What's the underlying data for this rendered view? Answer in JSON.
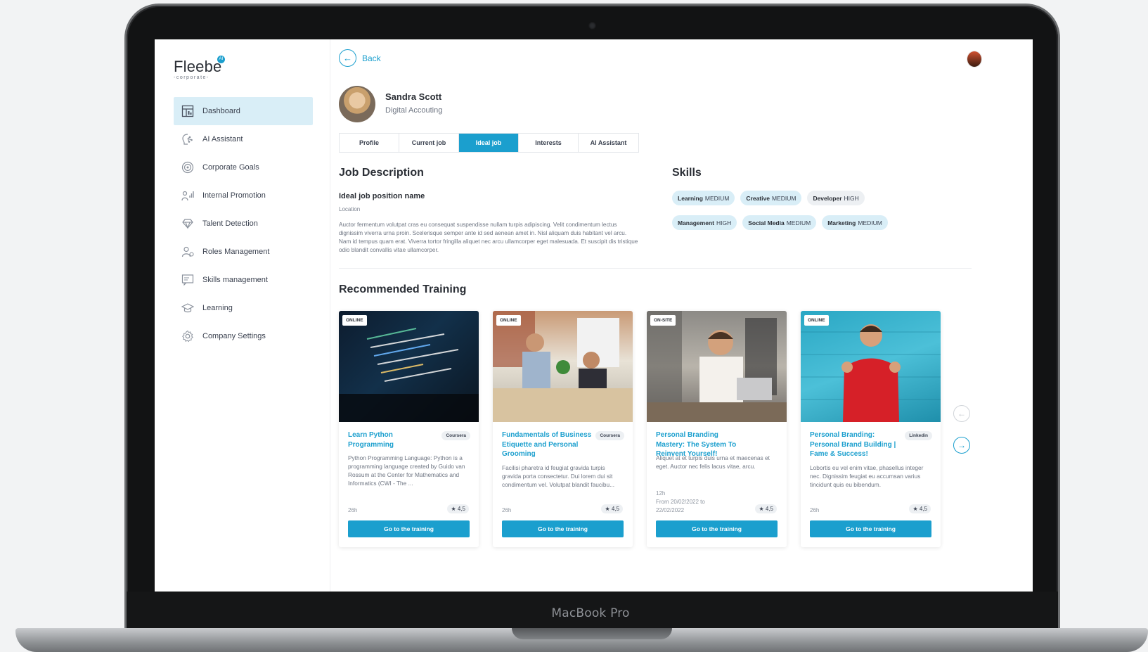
{
  "device": {
    "model_label": "MacBook Pro"
  },
  "brand": {
    "name": "Fleebe",
    "ai_badge": "AI",
    "subtitle": "-corporate-"
  },
  "sidebar": {
    "items": [
      {
        "label": "Dashboard",
        "icon": "dashboard-icon",
        "active": true
      },
      {
        "label": "AI Assistant",
        "icon": "ai-assistant-icon"
      },
      {
        "label": "Corporate Goals",
        "icon": "target-icon"
      },
      {
        "label": "Internal Promotion",
        "icon": "promotion-icon"
      },
      {
        "label": "Talent Detection",
        "icon": "diamond-icon"
      },
      {
        "label": "Roles Management",
        "icon": "users-icon"
      },
      {
        "label": "Skills management",
        "icon": "skills-icon"
      },
      {
        "label": "Learning",
        "icon": "graduation-cap-icon"
      },
      {
        "label": "Company Settings",
        "icon": "gear-icon"
      }
    ]
  },
  "header": {
    "back_label": "Back"
  },
  "profile": {
    "name": "Sandra Scott",
    "role": "Digital Accouting"
  },
  "tabs": [
    {
      "label": "Profile"
    },
    {
      "label": "Current job"
    },
    {
      "label": "Ideal job",
      "active": true
    },
    {
      "label": "Interests"
    },
    {
      "label": "AI Assistant"
    }
  ],
  "job": {
    "section_title": "Job Description",
    "position_name": "Ideal job position name",
    "location": "Location",
    "description": "Auctor fermentum volutpat cras eu consequat suspendisse nullam turpis adipiscing. Velit condimentum lectus dignissim viverra urna proin. Scelerisque semper ante id sed aenean amet in. Nisl aliquam duis habitant vel arcu. Nam id tempus quam erat. Viverra tortor fringilla aliquet nec arcu ullamcorper eget malesuada. Et suscipit dis tristique odio blandit convallis vitae ullamcorper."
  },
  "skills": {
    "section_title": "Skills",
    "items": [
      {
        "name": "Learning",
        "level": "MEDIUM"
      },
      {
        "name": "Creative",
        "level": "MEDIUM"
      },
      {
        "name": "Developer",
        "level": "HIGH"
      },
      {
        "name": "Management",
        "level": "HIGH"
      },
      {
        "name": "Social Media",
        "level": "MEDIUM"
      },
      {
        "name": "Marketing",
        "level": "MEDIUM"
      }
    ]
  },
  "training": {
    "section_title": "Recommended Training",
    "cards": [
      {
        "mode": "ONLINE",
        "title": "Learn Python Programming",
        "provider": "Coursera",
        "description": "Python Programming Language: Python is a programming language created by Guido van Rossum at the Center for Mathematics and Informatics (CWI - The ...",
        "duration": "26h",
        "rating": "4,5",
        "button": "Go to the training",
        "image": "code-laptop"
      },
      {
        "mode": "ONLINE",
        "title": "Fundamentals of Business Etiquette and Personal Grooming",
        "provider": "Coursera",
        "description": "Facilisi pharetra id feugiat gravida turpis gravida porta consectetur. Dui lorem dui sit condimentum vel. Volutpat blandit faucibu...",
        "duration": "26h",
        "rating": "4,5",
        "button": "Go to the training",
        "image": "office-high-five"
      },
      {
        "mode": "ON-SITE",
        "title": "Personal Branding Mastery: The System To Reinvent Yourself!",
        "provider": "",
        "description": "Aliquet at et turpis duis urna et maecenas et eget. Auctor nec felis lacus vitae, arcu.",
        "duration": "12h",
        "date_range": "From 20/02/2022 to 22/02/2022",
        "rating": "4,5",
        "button": "Go to the training",
        "image": "man-phone-laptop"
      },
      {
        "mode": "ONLINE",
        "title": "Personal Branding: Personal Brand Building | Fame & Success!",
        "provider": "Linkedin",
        "description": "Lobortis eu vel enim vitae, phasellus integer nec. Dignissim feugiat eu accumsan varius tincidunt quis eu bibendum.",
        "duration": "26h",
        "rating": "4,5",
        "button": "Go to the training",
        "image": "man-celebrating"
      }
    ]
  },
  "colors": {
    "accent": "#1b9fce",
    "chip_bg": "#d9eef7",
    "text": "#2b2f36",
    "muted": "#6e7582"
  }
}
